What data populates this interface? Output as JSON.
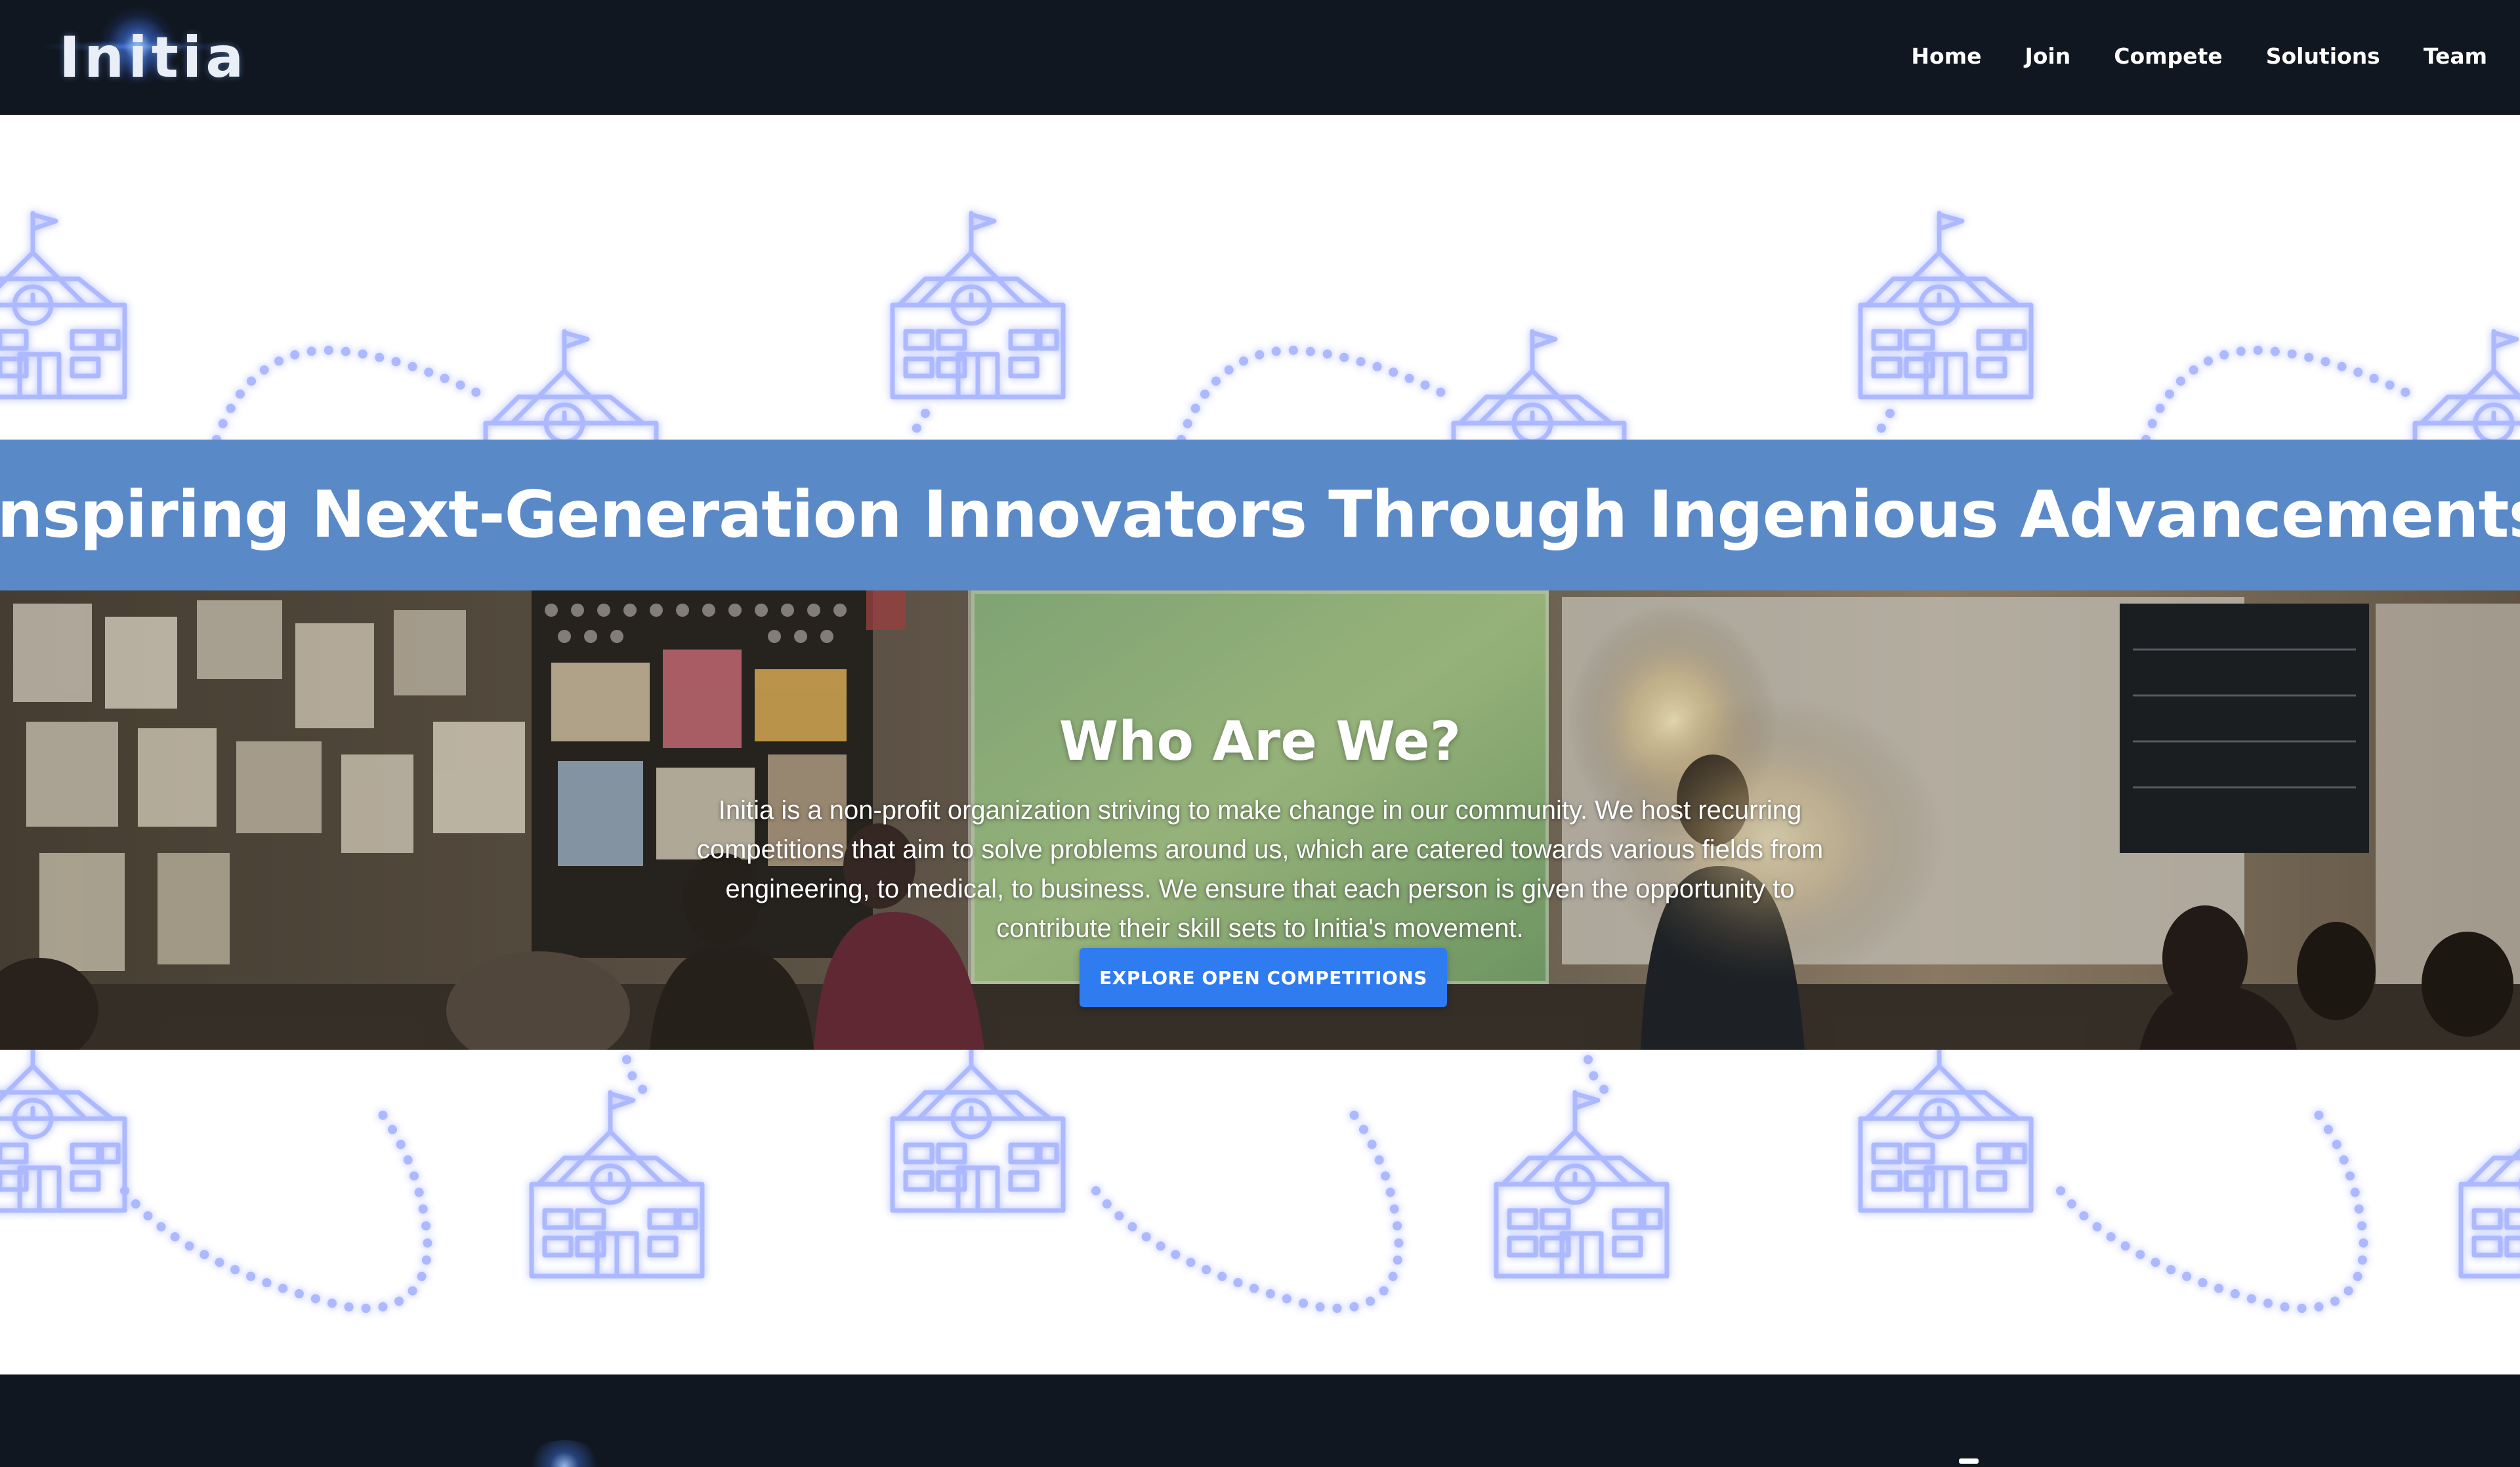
{
  "brand": {
    "logo_text": "Initia"
  },
  "nav": {
    "items": [
      {
        "label": "Home"
      },
      {
        "label": "Join"
      },
      {
        "label": "Compete"
      },
      {
        "label": "Solutions"
      },
      {
        "label": "Team"
      }
    ]
  },
  "headline": {
    "text": "Inspiring Next-Generation Innovators Through Ingenious Advancements"
  },
  "about": {
    "title": "Who Are We?",
    "description": "Initia is a non-profit organization striving to make change in our community. We host recurring competitions that aim to solve problems around us, which are catered towards various fields from engineering, to medical, to business. We ensure that each person is given the opportunity to contribute their skill sets to Initia's movement.",
    "button_label": "EXPLORE OPEN COMPETITIONS"
  },
  "colors": {
    "navbar_bg": "#111720",
    "headline_band": "#5a89c8",
    "button_bg": "#2f7bf0",
    "pattern_stroke": "#a9b6ff"
  },
  "icons": {
    "pattern": "school-building-icon",
    "pattern_path": "dotted-path-icon"
  }
}
